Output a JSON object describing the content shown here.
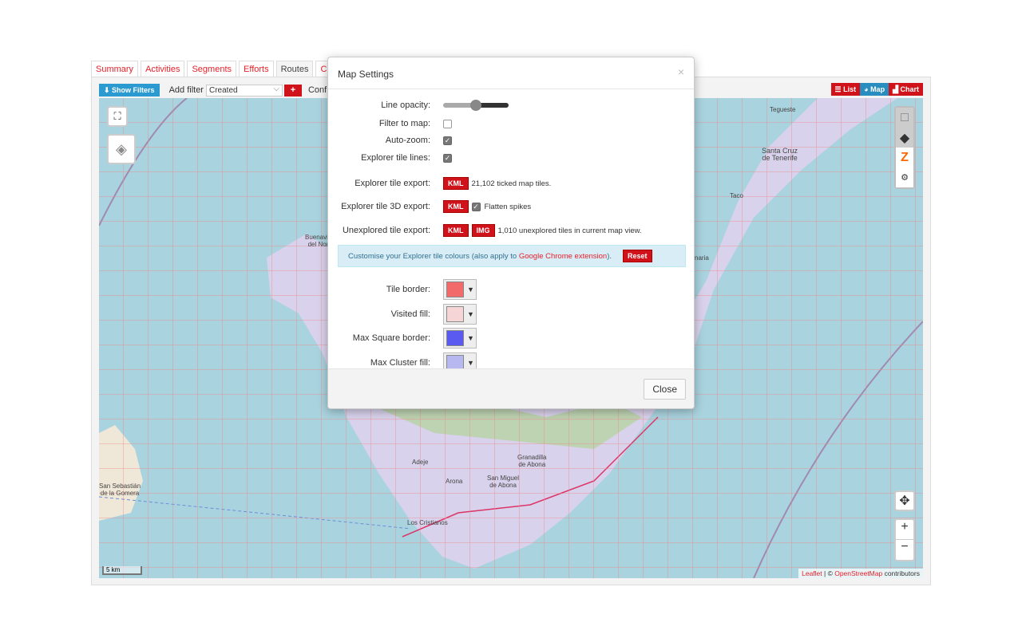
{
  "tabs": [
    {
      "label": "Summary"
    },
    {
      "label": "Activities"
    },
    {
      "label": "Segments"
    },
    {
      "label": "Efforts"
    },
    {
      "label": "Routes",
      "active": true
    },
    {
      "label": "Challe"
    }
  ],
  "toolbar": {
    "show_filters": "Show Filters",
    "add_filter": "Add filter",
    "filter_value": "Created",
    "config": "Config",
    "views": [
      "List",
      "Map",
      "Chart"
    ],
    "active_view": "Map"
  },
  "map": {
    "places": [
      "Tegueste",
      "Santa Cruz\nde Tenerife",
      "Buenavista\ndel Norte",
      "Adeje",
      "Granadilla\nde Abona",
      "Arona",
      "San Miguel\nde Abona",
      "Los Cristianos",
      "San Sebastián\nde la Gomera",
      "Taco",
      "naria"
    ],
    "scale": "5 km",
    "attribution": {
      "leaflet": "Leaflet",
      "sep": " | © ",
      "osm": "OpenStreetMap",
      "rest": " contributors"
    },
    "zoom_in": "+",
    "zoom_out": "−"
  },
  "modal": {
    "title": "Map Settings",
    "close_x": "×",
    "line_opacity_label": "Line opacity:",
    "line_opacity": 0.5,
    "filter_to_map_label": "Filter to map:",
    "filter_to_map": false,
    "auto_zoom_label": "Auto-zoom:",
    "auto_zoom": true,
    "tile_lines_label": "Explorer tile lines:",
    "tile_lines": true,
    "tile_export_label": "Explorer tile export:",
    "kml": "KML",
    "img": "IMG",
    "tile_export_text": "21,102 ticked map tiles.",
    "tile3d_label": "Explorer tile 3D export:",
    "flatten": "Flatten spikes",
    "flatten_checked": true,
    "unexplored_label": "Unexplored tile export:",
    "unexplored_text": "1,010 unexplored tiles in current map view.",
    "info_text": "Customise your Explorer tile colours (also apply to ",
    "info_link": "Google Chrome extension",
    "info_end": ").",
    "reset": "Reset",
    "colors": [
      {
        "label": "Tile border:",
        "color": "#f26a6a"
      },
      {
        "label": "Visited fill:",
        "color": "#f5d5d5"
      },
      {
        "label": "Max Square border:",
        "color": "#5a5af0"
      },
      {
        "label": "Max Cluster fill:",
        "color": "#b8b8f0"
      }
    ],
    "close": "Close"
  }
}
